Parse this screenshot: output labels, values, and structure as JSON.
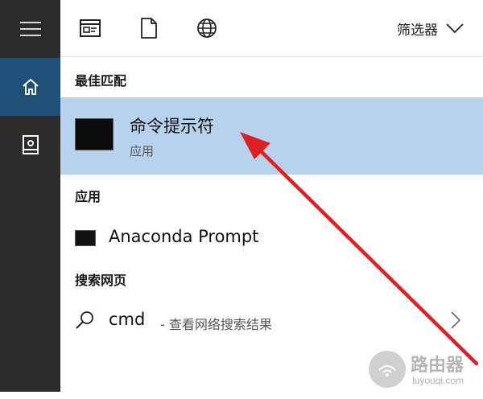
{
  "toolbar": {
    "filter_label": "筛选器"
  },
  "sections": {
    "best_match": "最佳匹配",
    "apps": "应用",
    "web": "搜索网页"
  },
  "best_match": {
    "name": "命令提示符",
    "type": "应用"
  },
  "apps": [
    {
      "name": "Anaconda Prompt"
    }
  ],
  "web_search": {
    "query": "cmd",
    "description": "- 查看网络搜索结果"
  },
  "watermark": {
    "text": "路由器",
    "sub": "luyouqi.com"
  },
  "colors": {
    "rail_bg": "#2b2b2b",
    "rail_selected": "#1d4f78",
    "selected_row": "#b6d2ec",
    "arrow": "#e02020"
  },
  "icons": {
    "rail": [
      "hamburger-menu-icon",
      "home-icon",
      "notebook-icon"
    ],
    "toolbar": [
      "app-window-icon",
      "document-icon",
      "globe-icon",
      "chevron-down-icon"
    ],
    "web": [
      "search-icon",
      "chevron-right-icon"
    ]
  }
}
